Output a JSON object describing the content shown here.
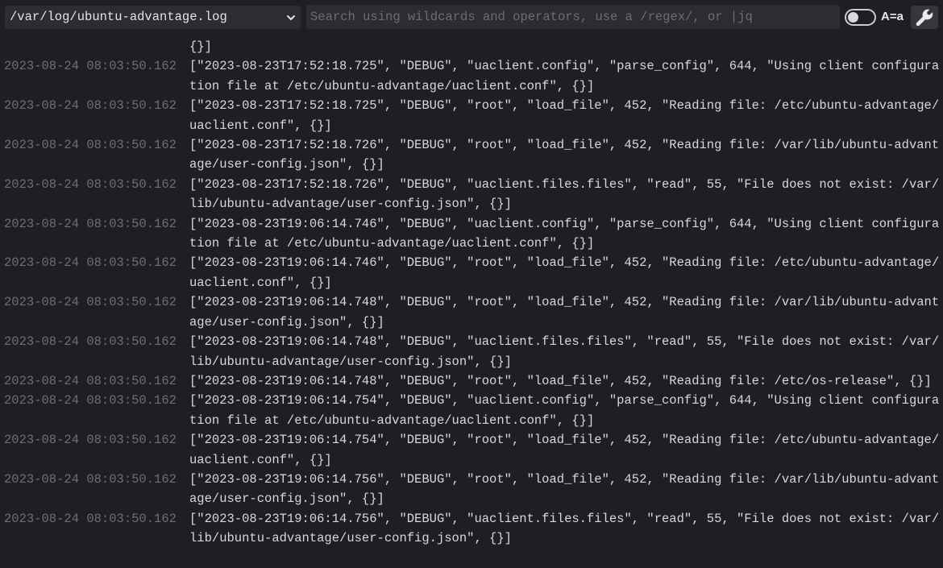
{
  "toolbar": {
    "file_path": "/var/log/ubuntu-advantage.log",
    "search_placeholder": "Search using wildcards and operators, use a /regex/, or |jq",
    "search_value": "",
    "case_sensitive_label": "A=a",
    "case_sensitive_on": false
  },
  "log": {
    "partial_tail": "{}]",
    "entries": [
      {
        "ts": "2023-08-24 08:03:50.162",
        "msg": "[\"2023-08-23T17:52:18.725\", \"DEBUG\", \"uaclient.config\", \"parse_config\", 644, \"Using client configuration file at /etc/ubuntu-advantage/uaclient.conf\", {}]"
      },
      {
        "ts": "2023-08-24 08:03:50.162",
        "msg": "[\"2023-08-23T17:52:18.725\", \"DEBUG\", \"root\", \"load_file\", 452, \"Reading file: /etc/ubuntu-advantage/uaclient.conf\", {}]"
      },
      {
        "ts": "2023-08-24 08:03:50.162",
        "msg": "[\"2023-08-23T17:52:18.726\", \"DEBUG\", \"root\", \"load_file\", 452, \"Reading file: /var/lib/ubuntu-advantage/user-config.json\", {}]"
      },
      {
        "ts": "2023-08-24 08:03:50.162",
        "msg": "[\"2023-08-23T17:52:18.726\", \"DEBUG\", \"uaclient.files.files\", \"read\", 55, \"File does not exist: /var/lib/ubuntu-advantage/user-config.json\", {}]"
      },
      {
        "ts": "2023-08-24 08:03:50.162",
        "msg": "[\"2023-08-23T19:06:14.746\", \"DEBUG\", \"uaclient.config\", \"parse_config\", 644, \"Using client configuration file at /etc/ubuntu-advantage/uaclient.conf\", {}]"
      },
      {
        "ts": "2023-08-24 08:03:50.162",
        "msg": "[\"2023-08-23T19:06:14.746\", \"DEBUG\", \"root\", \"load_file\", 452, \"Reading file: /etc/ubuntu-advantage/uaclient.conf\", {}]"
      },
      {
        "ts": "2023-08-24 08:03:50.162",
        "msg": "[\"2023-08-23T19:06:14.748\", \"DEBUG\", \"root\", \"load_file\", 452, \"Reading file: /var/lib/ubuntu-advantage/user-config.json\", {}]"
      },
      {
        "ts": "2023-08-24 08:03:50.162",
        "msg": "[\"2023-08-23T19:06:14.748\", \"DEBUG\", \"uaclient.files.files\", \"read\", 55, \"File does not exist: /var/lib/ubuntu-advantage/user-config.json\", {}]"
      },
      {
        "ts": "2023-08-24 08:03:50.162",
        "msg": "[\"2023-08-23T19:06:14.748\", \"DEBUG\", \"root\", \"load_file\", 452, \"Reading file: /etc/os-release\", {}]"
      },
      {
        "ts": "2023-08-24 08:03:50.162",
        "msg": "[\"2023-08-23T19:06:14.754\", \"DEBUG\", \"uaclient.config\", \"parse_config\", 644, \"Using client configuration file at /etc/ubuntu-advantage/uaclient.conf\", {}]"
      },
      {
        "ts": "2023-08-24 08:03:50.162",
        "msg": "[\"2023-08-23T19:06:14.754\", \"DEBUG\", \"root\", \"load_file\", 452, \"Reading file: /etc/ubuntu-advantage/uaclient.conf\", {}]"
      },
      {
        "ts": "2023-08-24 08:03:50.162",
        "msg": "[\"2023-08-23T19:06:14.756\", \"DEBUG\", \"root\", \"load_file\", 452, \"Reading file: /var/lib/ubuntu-advantage/user-config.json\", {}]"
      },
      {
        "ts": "2023-08-24 08:03:50.162",
        "msg": "[\"2023-08-23T19:06:14.756\", \"DEBUG\", \"uaclient.files.files\", \"read\", 55, \"File does not exist: /var/lib/ubuntu-advantage/user-config.json\", {}]"
      }
    ]
  },
  "icons": {
    "dropdown": "chevron-down-icon",
    "settings": "wrench-icon"
  },
  "colors": {
    "background": "#1e1f22",
    "input_background": "#2b2d30",
    "timestamp": "#6c6f75",
    "message": "#d7d8db"
  }
}
